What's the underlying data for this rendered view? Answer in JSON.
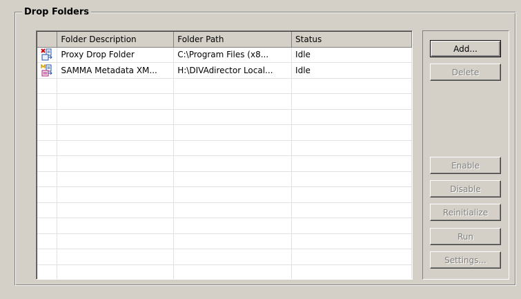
{
  "group": {
    "title": "Drop Folders"
  },
  "table": {
    "columns": [
      "",
      "Folder Description",
      "Folder Path",
      "Status"
    ],
    "rows": [
      {
        "icon": "proxy-drop-folder-icon",
        "description": "Proxy Drop Folder",
        "path": "C:\\Program Files (x8...",
        "status": "Idle"
      },
      {
        "icon": "metadata-drop-folder-icon",
        "description": "SAMMA Metadata XM...",
        "path": "H:\\DIVAdirector Local...",
        "status": "Idle"
      }
    ]
  },
  "buttons": {
    "add": "Add...",
    "delete": "Delete",
    "enable": "Enable",
    "disable": "Disable",
    "reinitialize": "Reinitialize",
    "run": "Run",
    "settings": "Settings..."
  }
}
